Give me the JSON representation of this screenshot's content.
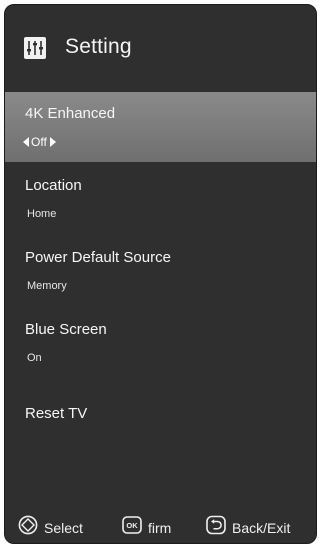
{
  "header": {
    "title": "Setting",
    "icon": "settings-sliders-icon"
  },
  "menu": {
    "items": [
      {
        "label": "4K Enhanced",
        "value": "Off",
        "selected": true
      },
      {
        "label": "Location",
        "value": "Home",
        "selected": false
      },
      {
        "label": "Power Default Source",
        "value": "Memory",
        "selected": false
      },
      {
        "label": "Blue Screen",
        "value": "On",
        "selected": false
      },
      {
        "label": "Reset TV",
        "selected": false
      }
    ]
  },
  "footer": {
    "hints": [
      {
        "icon": "navigation-pad-icon",
        "label": "Select"
      },
      {
        "icon": "ok-key-icon",
        "key": "OK",
        "label": "firm"
      },
      {
        "icon": "back-return-icon",
        "label": "Back/Exit"
      }
    ]
  },
  "colors": {
    "background": "#2f2f2f",
    "highlight": "#7c7c7c",
    "text": "#f2f2f2"
  }
}
